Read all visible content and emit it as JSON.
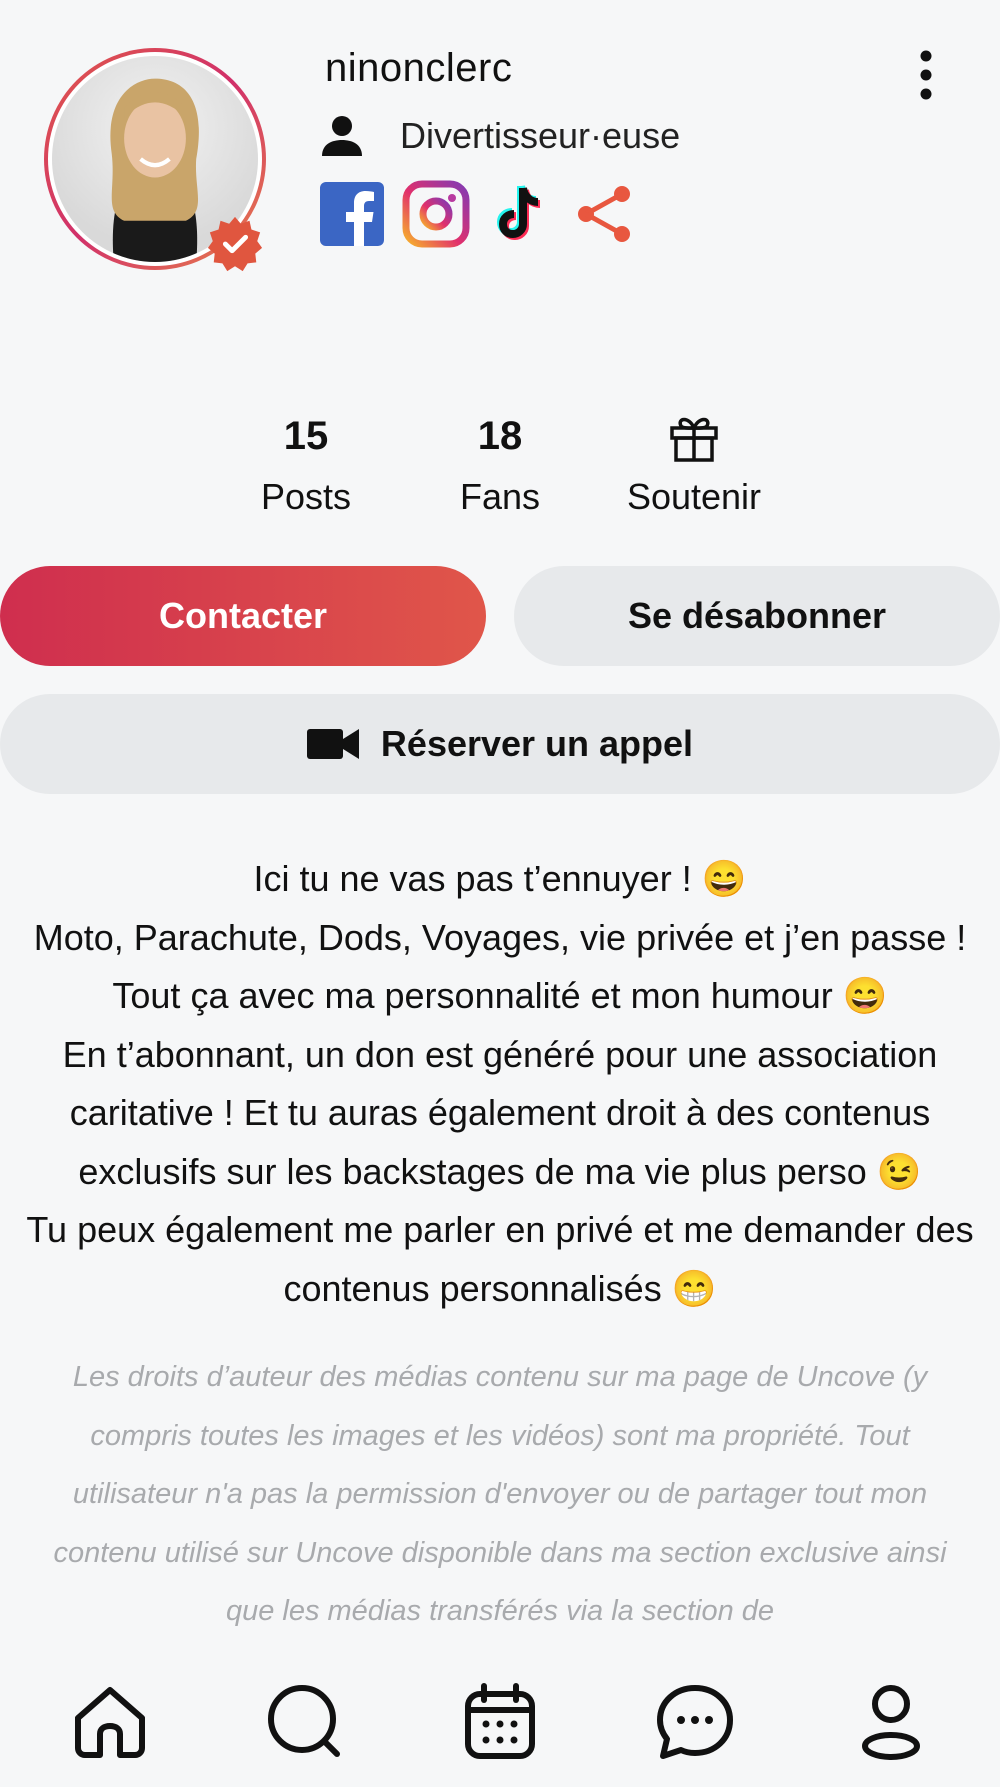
{
  "profile": {
    "username": "ninonclerc",
    "category": "Divertisseur·euse",
    "socials": [
      "facebook-icon",
      "instagram-icon",
      "tiktok-icon",
      "share-icon"
    ]
  },
  "stats": {
    "posts_count": "15",
    "posts_label": "Posts",
    "fans_count": "18",
    "fans_label": "Fans",
    "support_label": "Soutenir"
  },
  "actions": {
    "contact_label": "Contacter",
    "unsubscribe_label": "Se désabonner",
    "book_call_label": "Réserver un appel"
  },
  "bio": {
    "line1": "Ici tu ne vas pas t’ennuyer ! 😄",
    "line2": "Moto, Parachute, Dods, Voyages, vie privée et j’en passe ! Tout ça avec ma personnalité et mon humour 😄",
    "line3": "En t’abonnant, un don est généré pour une association caritative  ! Et tu auras également droit à des contenus exclusifs sur les backstages de ma vie plus perso 😉",
    "line4": "Tu peux également me parler en privé et me demander des contenus personnalisés 😁"
  },
  "legal": {
    "text": "Les droits d’auteur des médias contenu sur ma page de Uncove (y compris toutes les images et les vidéos) sont ma propriété. Tout utilisateur n'a pas la permission d'envoyer ou de partager tout mon contenu utilisé sur Uncove disponible dans ma section exclusive ainsi que les médias transférés via la section de"
  },
  "colors": {
    "accent_start": "#cf2e4e",
    "accent_end": "#e0564a",
    "secondary_button": "#e7e9eb",
    "muted_text": "#a8aaad",
    "verified_badge": "#e0563f"
  },
  "nav": {
    "items": [
      "home-icon",
      "search-icon",
      "calendar-icon",
      "chat-icon",
      "profile-icon"
    ]
  }
}
